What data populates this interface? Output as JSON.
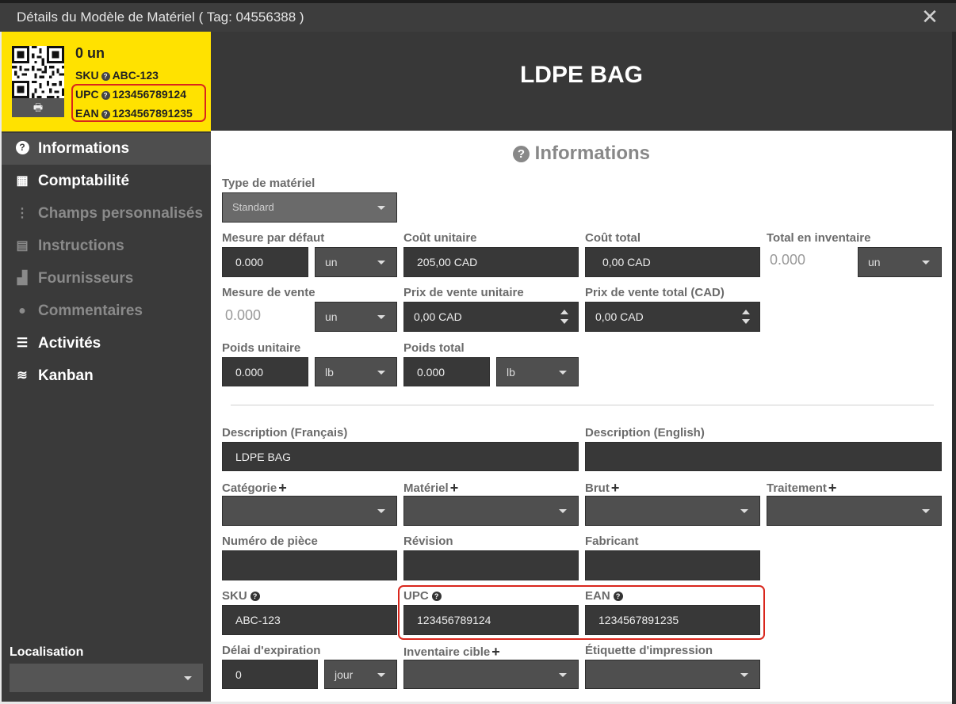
{
  "window": {
    "title": "Détails du Modèle de Matériel ( Tag: 04556388 )",
    "close_icon": "close-icon"
  },
  "card": {
    "units": "0 un",
    "sku_label": "SKU",
    "sku_value": "ABC-123",
    "upc_label": "UPC",
    "upc_value": "123456789124",
    "ean_label": "EAN",
    "ean_value": "1234567891235",
    "print_icon": "print-icon"
  },
  "nav": {
    "items": [
      {
        "label": "Informations",
        "icon": "question-circle-icon",
        "glyph": "?",
        "state": "active"
      },
      {
        "label": "Comptabilité",
        "icon": "calculator-icon",
        "glyph": "▦",
        "state": "enabled"
      },
      {
        "label": "Champs personnalisés",
        "icon": "vertical-dots-icon",
        "glyph": "⋮",
        "state": "disabled"
      },
      {
        "label": "Instructions",
        "icon": "document-icon",
        "glyph": "▤",
        "state": "disabled"
      },
      {
        "label": "Fournisseurs",
        "icon": "bar-chart-icon",
        "glyph": "▟",
        "state": "disabled"
      },
      {
        "label": "Commentaires",
        "icon": "comment-icon",
        "glyph": "●",
        "state": "disabled"
      },
      {
        "label": "Activités",
        "icon": "list-icon",
        "glyph": "☰",
        "state": "enabled"
      },
      {
        "label": "Kanban",
        "icon": "database-icon",
        "glyph": "≋",
        "state": "enabled"
      }
    ]
  },
  "localisation": {
    "label": "Localisation",
    "value": ""
  },
  "header": {
    "title": "LDPE BAG"
  },
  "section": {
    "title": "Informations",
    "icon": "question-circle-icon"
  },
  "form": {
    "type_materiel": {
      "label": "Type de matériel",
      "value": "Standard"
    },
    "mesure_defaut": {
      "label": "Mesure par défaut",
      "value": "0.000",
      "unit": "un"
    },
    "cout_unitaire": {
      "label": "Coût unitaire",
      "value": "205,00 CAD"
    },
    "cout_total": {
      "label": "Coût total",
      "value": "0,00 CAD"
    },
    "total_inventaire": {
      "label": "Total en inventaire",
      "value": "0.000",
      "unit": "un"
    },
    "mesure_vente": {
      "label": "Mesure de vente",
      "value": "0.000",
      "unit": "un"
    },
    "prix_vente_unitaire": {
      "label": "Prix de vente unitaire",
      "value": "0,00 CAD"
    },
    "prix_vente_total": {
      "label": "Prix de vente total (CAD)",
      "value": "0,00 CAD"
    },
    "poids_unitaire": {
      "label": "Poids unitaire",
      "value": "0.000",
      "unit": "lb"
    },
    "poids_total": {
      "label": "Poids total",
      "value": "0.000",
      "unit": "lb"
    },
    "description_fr": {
      "label": "Description (Français)",
      "value": "LDPE BAG"
    },
    "description_en": {
      "label": "Description (English)",
      "value": ""
    },
    "categorie": {
      "label": "Catégorie",
      "value": ""
    },
    "materiel": {
      "label": "Matériel",
      "value": ""
    },
    "brut": {
      "label": "Brut",
      "value": ""
    },
    "traitement": {
      "label": "Traitement",
      "value": ""
    },
    "numero_piece": {
      "label": "Numéro de pièce",
      "value": ""
    },
    "revision": {
      "label": "Révision",
      "value": ""
    },
    "fabricant": {
      "label": "Fabricant",
      "value": ""
    },
    "sku": {
      "label": "SKU",
      "value": "ABC-123"
    },
    "upc": {
      "label": "UPC",
      "value": "123456789124"
    },
    "ean": {
      "label": "EAN",
      "value": "1234567891235"
    },
    "delai_expiration": {
      "label": "Délai d'expiration",
      "value": "0",
      "unit": "jour"
    },
    "inventaire_cible": {
      "label": "Inventaire cible",
      "value": ""
    },
    "etiquette_impression": {
      "label": "Étiquette d'impression",
      "value": ""
    }
  },
  "colors": {
    "accent": "#ffe200",
    "highlight": "#d9261c",
    "sidebar": "#3a3a3a",
    "field": "#383838"
  }
}
